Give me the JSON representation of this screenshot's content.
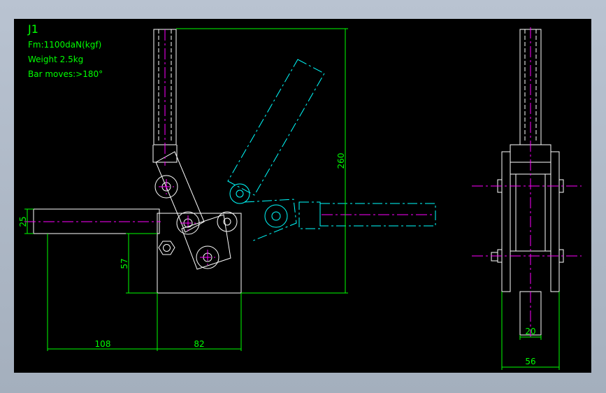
{
  "drawing": {
    "title": "J1",
    "spec_force": "Fm:1100daN(kgf)",
    "spec_weight": "Weight 2.5kg",
    "spec_bar": "Bar moves:>180°"
  },
  "dimensions": {
    "height_total": "260",
    "bar_dia": "25",
    "base_height": "57",
    "reach": "108",
    "base_width": "82",
    "side_inner": "20",
    "side_outer": "56"
  },
  "colors": {
    "background": "#000000",
    "outline": "#ffffff",
    "dimension": "#00ff00",
    "centerline": "#ff00ff",
    "alt_position": "#00ffff"
  }
}
